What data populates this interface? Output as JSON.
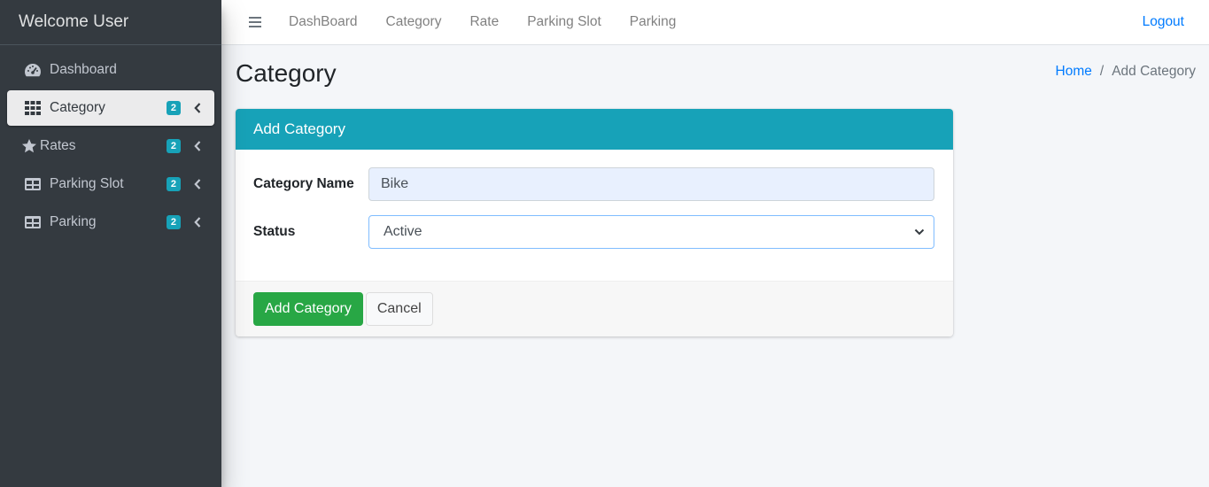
{
  "sidebar": {
    "brand": "Welcome User",
    "items": [
      {
        "label": "Dashboard",
        "icon": "tachometer-icon"
      },
      {
        "label": "Category",
        "icon": "grid-icon",
        "badge": "2"
      },
      {
        "label": "Rates",
        "icon": "star-icon",
        "badge": "2"
      },
      {
        "label": "Parking Slot",
        "icon": "table-icon",
        "badge": "2"
      },
      {
        "label": "Parking",
        "icon": "table-icon",
        "badge": "2"
      }
    ]
  },
  "topbar": {
    "links": [
      "DashBoard",
      "Category",
      "Rate",
      "Parking Slot",
      "Parking"
    ],
    "logout": "Logout"
  },
  "page": {
    "title": "Category",
    "breadcrumb": {
      "home": "Home",
      "separator": "/",
      "current": "Add Category"
    }
  },
  "card": {
    "header": "Add Category",
    "fields": {
      "name_label": "Category Name",
      "name_value": "Bike",
      "status_label": "Status",
      "status_value": "Active"
    },
    "buttons": {
      "submit": "Add Category",
      "cancel": "Cancel"
    }
  },
  "colors": {
    "sidebar_bg": "#343a40",
    "card_header": "#17a2b8",
    "badge": "#17a2b8",
    "success": "#28a745",
    "link": "#007bff"
  }
}
